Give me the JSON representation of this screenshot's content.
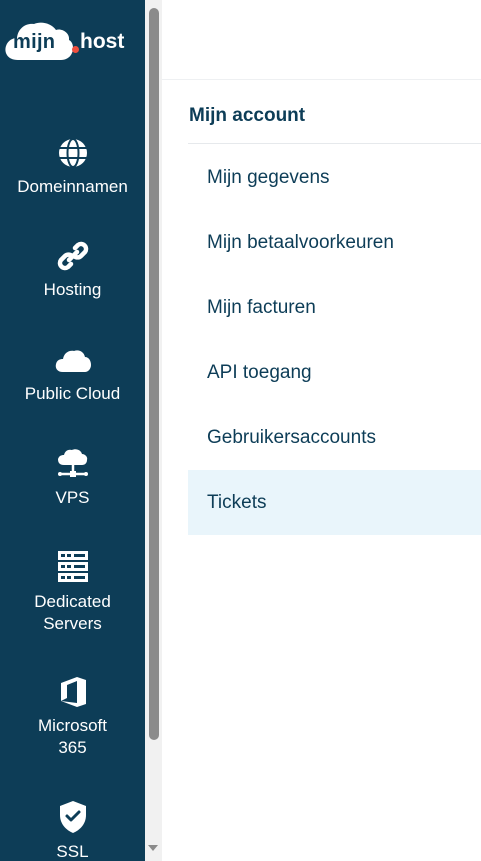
{
  "logo": {
    "part1": "mijn",
    "part2": "host"
  },
  "nav": [
    {
      "label": "Domeinnamen",
      "icon": "globe-icon"
    },
    {
      "label": "Hosting",
      "icon": "link-icon"
    },
    {
      "label": "Public Cloud",
      "icon": "cloud-icon"
    },
    {
      "label": "VPS",
      "icon": "cloud-network-icon"
    },
    {
      "label": "Dedicated\nServers",
      "icon": "server-rack-icon"
    },
    {
      "label": "Microsoft\n365",
      "icon": "office-icon"
    },
    {
      "label": "SSL",
      "icon": "shield-check-icon"
    }
  ],
  "account": {
    "title": "Mijn account",
    "items": [
      {
        "label": "Mijn gegevens"
      },
      {
        "label": "Mijn betaalvoorkeuren"
      },
      {
        "label": "Mijn facturen"
      },
      {
        "label": "API toegang"
      },
      {
        "label": "Gebruikersaccounts"
      },
      {
        "label": "Tickets",
        "active": true
      }
    ]
  },
  "colors": {
    "sidebar": "#0d3d57",
    "accent": "#ef4f3e",
    "active_bg": "#e9f5fb",
    "text": "#0d3d57"
  }
}
